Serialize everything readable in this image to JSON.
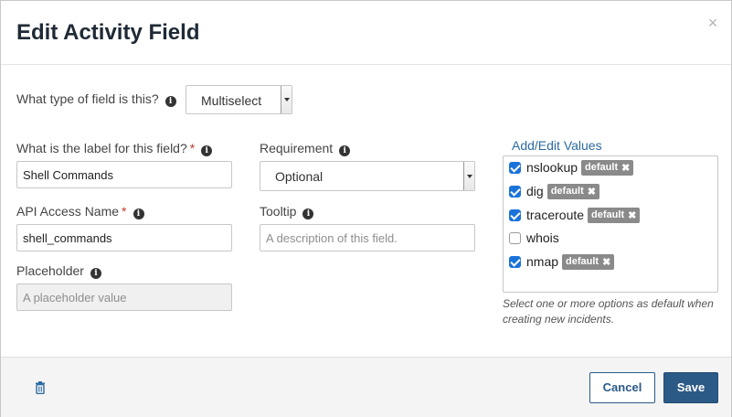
{
  "dialog": {
    "title": "Edit Activity Field",
    "close_label": "×"
  },
  "field_type": {
    "label": "What type of field is this?",
    "value": "Multiselect"
  },
  "label_field": {
    "label": "What is the label for this field?",
    "required_mark": "*",
    "value": "Shell Commands"
  },
  "requirement": {
    "label": "Requirement",
    "value": "Optional"
  },
  "api_name": {
    "label": "API Access Name",
    "required_mark": "*",
    "value": "shell_commands"
  },
  "tooltip": {
    "label": "Tooltip",
    "placeholder": "A description of this field."
  },
  "placeholder_field": {
    "label": "Placeholder",
    "placeholder": "A placeholder value"
  },
  "values": {
    "header": "Add/Edit Values",
    "items": [
      {
        "label": "nslookup",
        "checked": true,
        "badge": "default"
      },
      {
        "label": "dig",
        "checked": true,
        "badge": "default"
      },
      {
        "label": "traceroute",
        "checked": true,
        "badge": "default"
      },
      {
        "label": "whois",
        "checked": false,
        "badge": ""
      },
      {
        "label": "nmap",
        "checked": true,
        "badge": "default"
      }
    ],
    "hint": "Select one or more options as default when creating new incidents."
  },
  "footer": {
    "cancel_label": "Cancel",
    "save_label": "Save"
  },
  "icons": {
    "info": "info-icon",
    "trash": "trash-icon",
    "close": "close-icon"
  },
  "colors": {
    "primary": "#2c5a86",
    "link": "#2b6aa0",
    "required": "#c0392b",
    "checkbox": "#1a73d9",
    "badge": "#8a8a8a"
  }
}
